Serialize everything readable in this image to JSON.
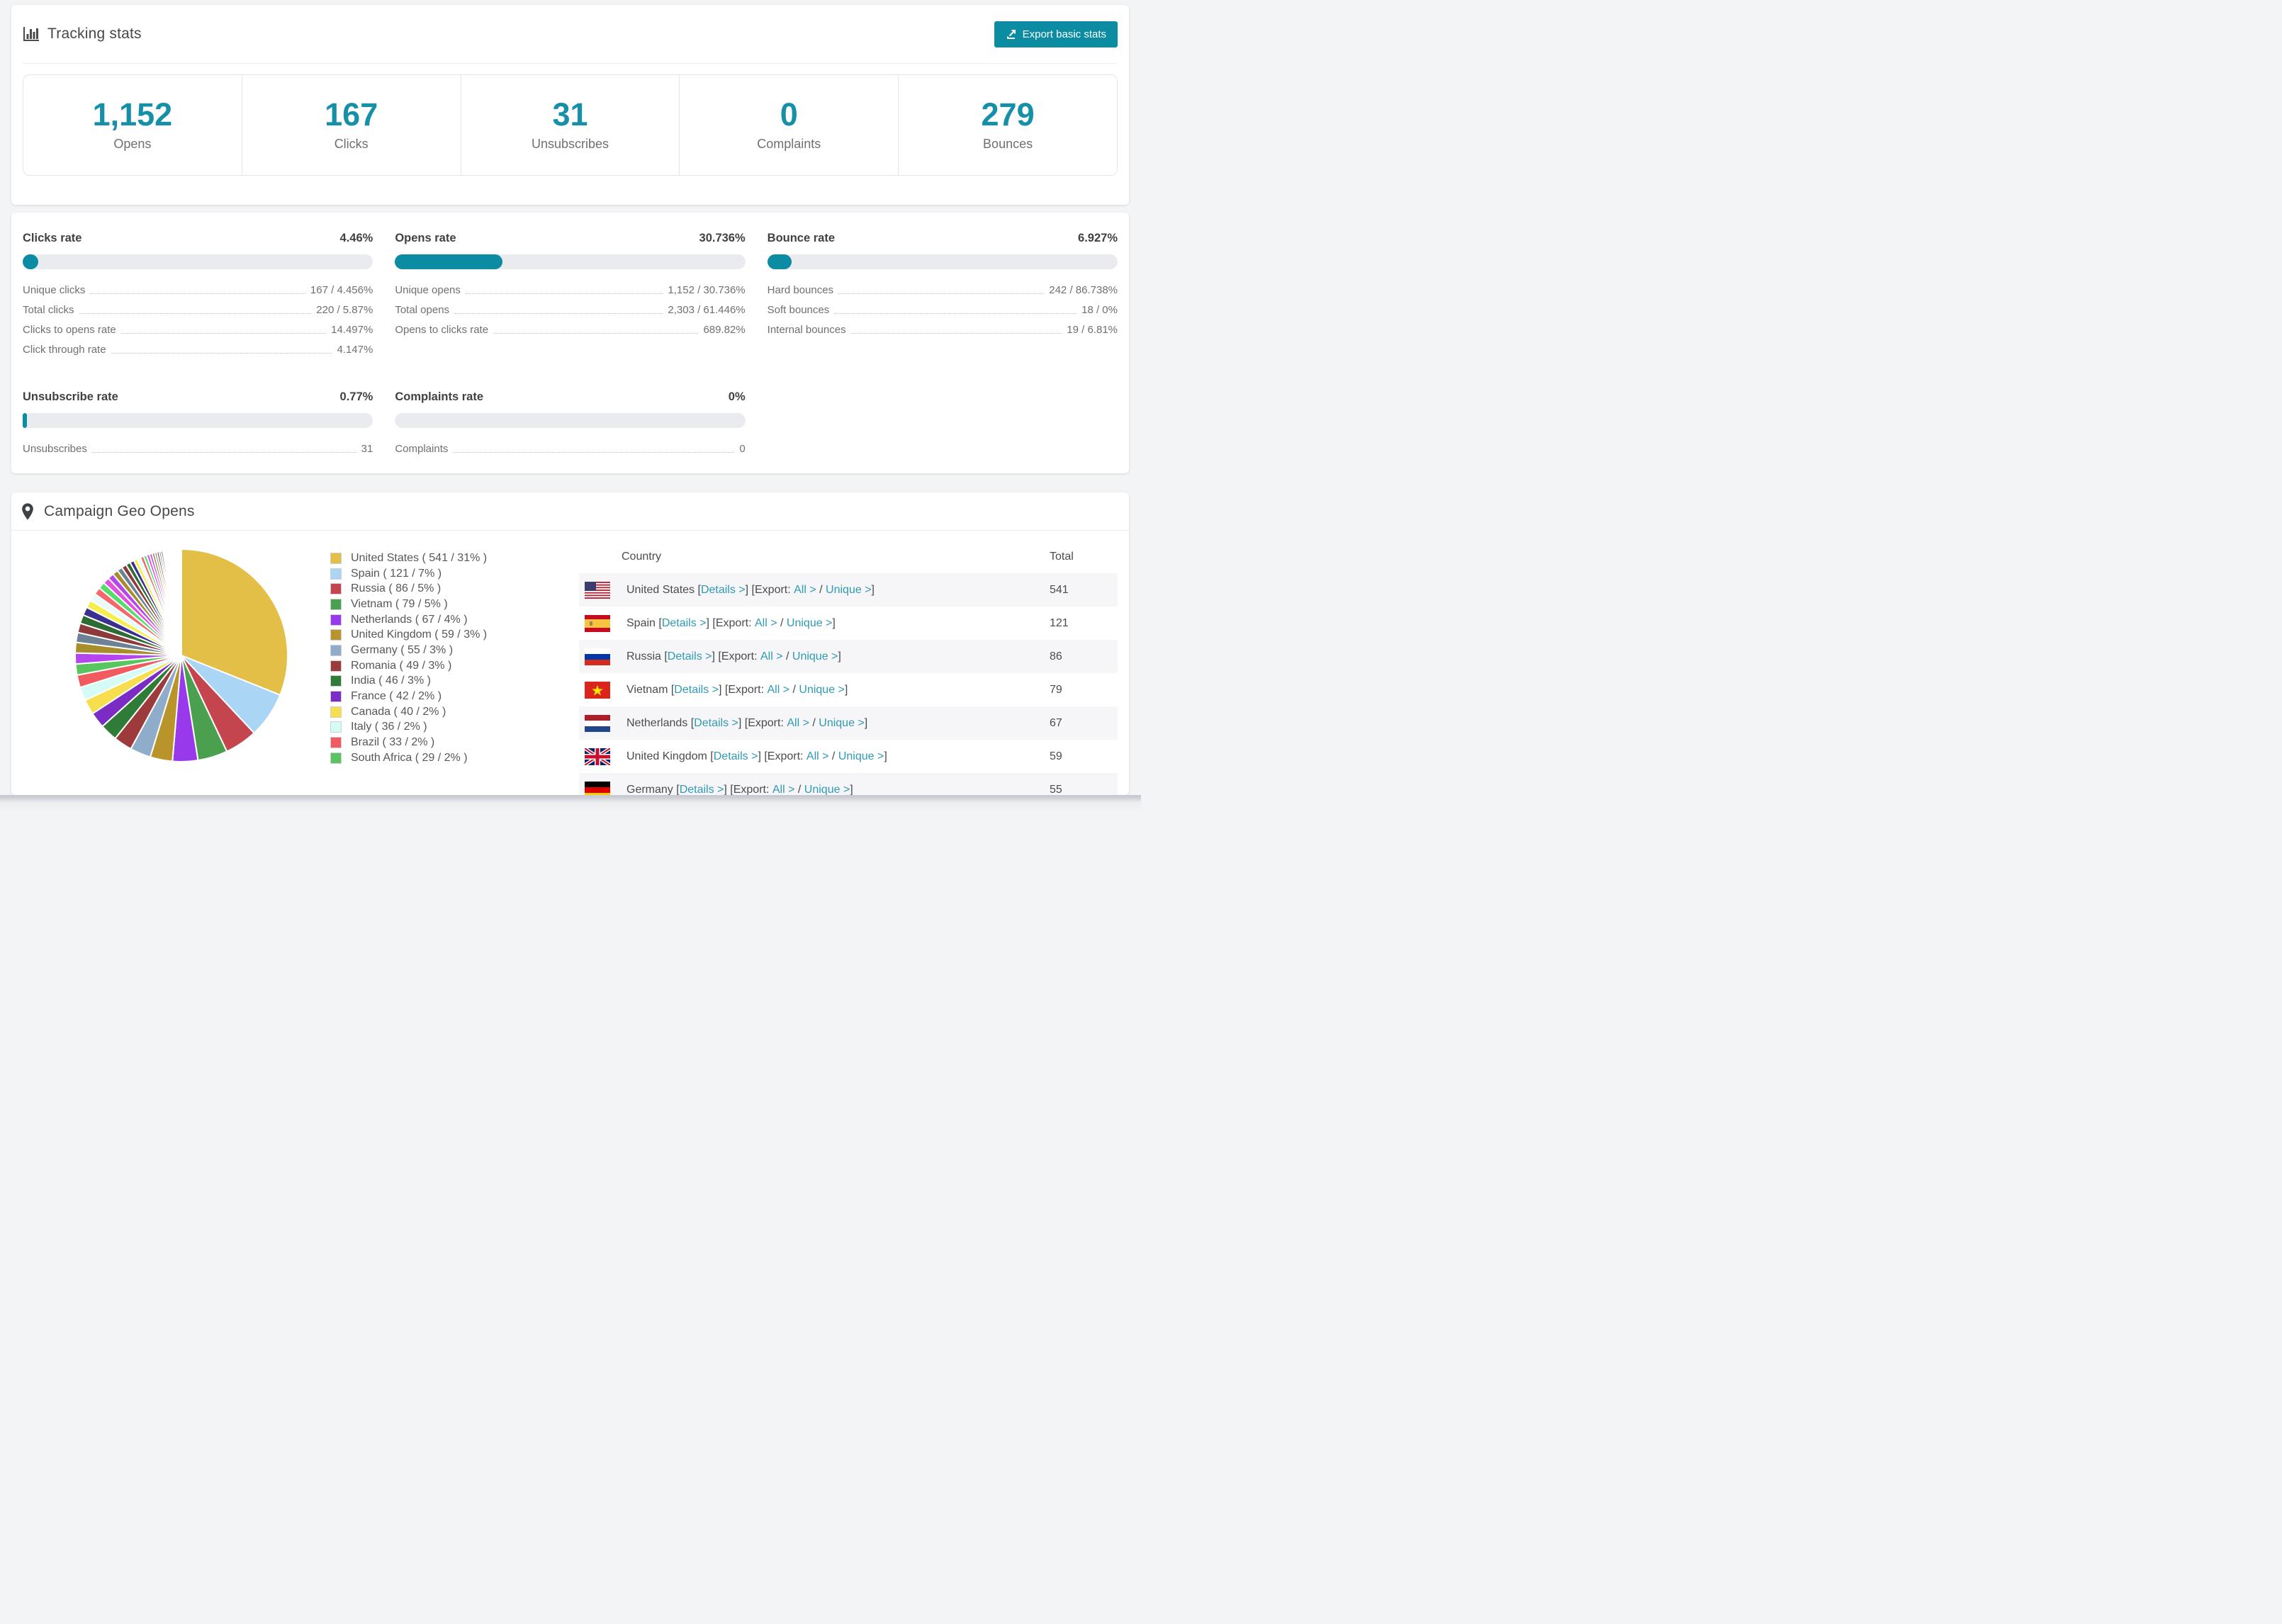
{
  "colors": {
    "accent": "#0c8ca3",
    "stat_number": "#1590a8",
    "link": "#2f9ab4",
    "bar_track": "#e9ebee",
    "row_stripe": "#f6f6f8",
    "title_text": "#46494c",
    "label_text": "#6d7073"
  },
  "tracking": {
    "title": "Tracking stats",
    "export_button": {
      "label": "Export basic stats"
    },
    "stats": [
      {
        "value": "1,152",
        "label": "Opens"
      },
      {
        "value": "167",
        "label": "Clicks"
      },
      {
        "value": "31",
        "label": "Unsubscribes"
      },
      {
        "value": "0",
        "label": "Complaints"
      },
      {
        "value": "279",
        "label": "Bounces"
      }
    ]
  },
  "rates": {
    "blocks": [
      {
        "title": "Clicks rate",
        "value": "4.46%",
        "bar_pct": 4.46,
        "rows": [
          [
            "Unique clicks",
            "167 / 4.456%"
          ],
          [
            "Total clicks",
            "220 / 5.87%"
          ],
          [
            "Clicks to opens rate",
            "14.497%"
          ],
          [
            "Click through rate",
            "4.147%"
          ]
        ]
      },
      {
        "title": "Opens rate",
        "value": "30.736%",
        "bar_pct": 30.736,
        "rows": [
          [
            "Unique opens",
            "1,152 / 30.736%"
          ],
          [
            "Total opens",
            "2,303 / 61.446%"
          ],
          [
            "Opens to clicks rate",
            "689.82%"
          ]
        ]
      },
      {
        "title": "Bounce rate",
        "value": "6.927%",
        "bar_pct": 6.927,
        "rows": [
          [
            "Hard bounces",
            "242 / 86.738%"
          ],
          [
            "Soft bounces",
            "18 / 0%"
          ],
          [
            "Internal bounces",
            "19 / 6.81%"
          ]
        ]
      },
      {
        "title": "Unsubscribe rate",
        "value": "0.77%",
        "bar_pct": 0.77,
        "rows": [
          [
            "Unsubscribes",
            "31"
          ]
        ]
      },
      {
        "title": "Complaints rate",
        "value": "0%",
        "bar_pct": 0,
        "rows": [
          [
            "Complaints",
            "0"
          ]
        ]
      }
    ]
  },
  "chart_data": {
    "type": "pie",
    "title": "Campaign Geo Opens",
    "legend_position": "right",
    "start_angle_deg": -90,
    "direction": "clockwise",
    "slices": [
      {
        "label": "United States",
        "value": 541,
        "pct": "31%",
        "color": "#e4bf47"
      },
      {
        "label": "Spain",
        "value": 121,
        "pct": "7%",
        "color": "#abd5f5"
      },
      {
        "label": "Russia",
        "value": 86,
        "pct": "5%",
        "color": "#c4454e"
      },
      {
        "label": "Vietnam",
        "value": 79,
        "pct": "5%",
        "color": "#4ba050"
      },
      {
        "label": "Netherlands",
        "value": 67,
        "pct": "4%",
        "color": "#9939ec"
      },
      {
        "label": "United Kingdom",
        "value": 59,
        "pct": "3%",
        "color": "#b8942b"
      },
      {
        "label": "Germany",
        "value": 55,
        "pct": "3%",
        "color": "#8fadca"
      },
      {
        "label": "Romania",
        "value": 49,
        "pct": "3%",
        "color": "#9c3a3c"
      },
      {
        "label": "India",
        "value": 46,
        "pct": "3%",
        "color": "#2f7c39"
      },
      {
        "label": "France",
        "value": 42,
        "pct": "2%",
        "color": "#7b2cc4"
      },
      {
        "label": "Canada",
        "value": 40,
        "pct": "2%",
        "color": "#f6de4e"
      },
      {
        "label": "Italy",
        "value": 36,
        "pct": "2%",
        "color": "#d4fbf6"
      },
      {
        "label": "Brazil",
        "value": 33,
        "pct": "2%",
        "color": "#f15b60"
      },
      {
        "label": "South Africa",
        "value": 29,
        "pct": "2%",
        "color": "#58c55f"
      }
    ],
    "others": {
      "values": [
        29,
        28,
        26,
        25,
        23,
        22,
        21,
        20,
        19,
        18,
        17,
        16,
        15,
        14,
        13,
        12,
        11,
        10,
        9,
        9,
        8,
        8,
        7,
        7,
        6,
        6,
        5,
        5,
        4,
        4,
        4,
        3,
        3,
        3,
        3,
        2,
        2,
        2,
        2,
        2,
        2,
        1,
        1,
        1,
        1,
        1,
        1,
        1,
        1,
        1,
        1,
        1,
        1,
        1
      ],
      "palette": [
        "#b546ee",
        "#a78e2b",
        "#6e8296",
        "#8e3a3a",
        "#2d6b35",
        "#3b2f8f",
        "#f5ee4d",
        "#e8fbfa",
        "#f2686c",
        "#54dd6a",
        "#e250df"
      ]
    }
  },
  "geo": {
    "title": "Campaign Geo Opens",
    "table": {
      "headers": [
        "Country",
        "Total"
      ],
      "labels": {
        "open_bracket": "[",
        "close_bracket": "]",
        "export_label": "Export:",
        "details_label": "Details >",
        "all_label": "All >",
        "unique_label": "Unique >",
        "slash": "/"
      },
      "rows": [
        {
          "country": "United States",
          "flag": "us",
          "total": "541"
        },
        {
          "country": "Spain",
          "flag": "es",
          "total": "121"
        },
        {
          "country": "Russia",
          "flag": "ru",
          "total": "86"
        },
        {
          "country": "Vietnam",
          "flag": "vn",
          "total": "79"
        },
        {
          "country": "Netherlands",
          "flag": "nl",
          "total": "67"
        },
        {
          "country": "United Kingdom",
          "flag": "gb",
          "total": "59"
        },
        {
          "country": "Germany",
          "flag": "de",
          "total": "55"
        }
      ]
    }
  }
}
